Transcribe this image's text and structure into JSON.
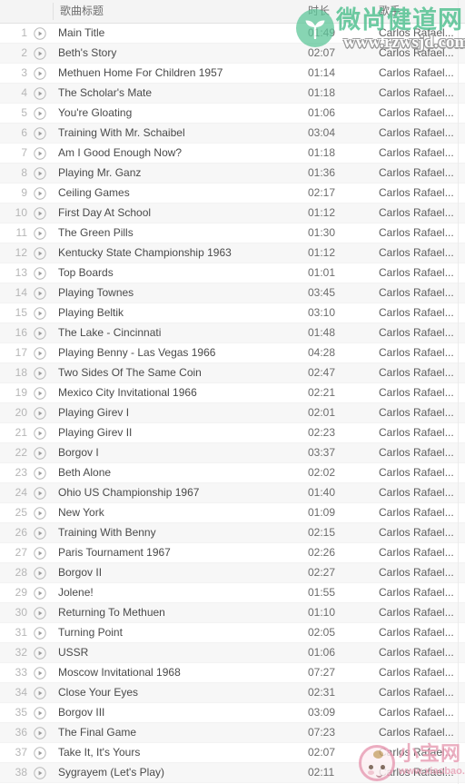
{
  "header": {
    "title_label": "歌曲标题",
    "duration_label": "时长",
    "artist_label": "歌手"
  },
  "colors": {
    "row_alt": "#f7f7f7",
    "header_bg": "#f4f4f4",
    "text": "#4a4a4a",
    "muted": "#b6b6b6",
    "watermark_green": "#4dbf8e",
    "watermark_pink": "#e79db3"
  },
  "icons": {
    "play": "play-circle-icon",
    "sprout": "sprout-logo-icon",
    "baby": "baby-face-icon"
  },
  "watermarks": {
    "top": {
      "brand": "微尚健道网",
      "url": "www.rzwsjd.com"
    },
    "bottom": {
      "brand": "小宝网",
      "url": "www.xiaobao.com"
    }
  },
  "tracks": [
    {
      "index": "1",
      "title": "Main Title",
      "duration": "01:49",
      "artist": "Carlos Rafael..."
    },
    {
      "index": "2",
      "title": "Beth's Story",
      "duration": "02:07",
      "artist": "Carlos Rafael..."
    },
    {
      "index": "3",
      "title": "Methuen Home For Children 1957",
      "duration": "01:14",
      "artist": "Carlos Rafael..."
    },
    {
      "index": "4",
      "title": "The Scholar's Mate",
      "duration": "01:18",
      "artist": "Carlos Rafael..."
    },
    {
      "index": "5",
      "title": "You're Gloating",
      "duration": "01:06",
      "artist": "Carlos Rafael..."
    },
    {
      "index": "6",
      "title": "Training With Mr. Schaibel",
      "duration": "03:04",
      "artist": "Carlos Rafael..."
    },
    {
      "index": "7",
      "title": "Am I Good Enough Now?",
      "duration": "01:18",
      "artist": "Carlos Rafael..."
    },
    {
      "index": "8",
      "title": "Playing Mr. Ganz",
      "duration": "01:36",
      "artist": "Carlos Rafael..."
    },
    {
      "index": "9",
      "title": "Ceiling Games",
      "duration": "02:17",
      "artist": "Carlos Rafael..."
    },
    {
      "index": "10",
      "title": "First Day At School",
      "duration": "01:12",
      "artist": "Carlos Rafael..."
    },
    {
      "index": "11",
      "title": "The Green Pills",
      "duration": "01:30",
      "artist": "Carlos Rafael..."
    },
    {
      "index": "12",
      "title": "Kentucky State Championship 1963",
      "duration": "01:12",
      "artist": "Carlos Rafael..."
    },
    {
      "index": "13",
      "title": "Top Boards",
      "duration": "01:01",
      "artist": "Carlos Rafael..."
    },
    {
      "index": "14",
      "title": "Playing Townes",
      "duration": "03:45",
      "artist": "Carlos Rafael..."
    },
    {
      "index": "15",
      "title": "Playing Beltik",
      "duration": "03:10",
      "artist": "Carlos Rafael..."
    },
    {
      "index": "16",
      "title": "The Lake - Cincinnati",
      "duration": "01:48",
      "artist": "Carlos Rafael..."
    },
    {
      "index": "17",
      "title": "Playing Benny - Las Vegas 1966",
      "duration": "04:28",
      "artist": "Carlos Rafael..."
    },
    {
      "index": "18",
      "title": "Two Sides Of The Same Coin",
      "duration": "02:47",
      "artist": "Carlos Rafael..."
    },
    {
      "index": "19",
      "title": "Mexico City Invitational 1966",
      "duration": "02:21",
      "artist": "Carlos Rafael..."
    },
    {
      "index": "20",
      "title": "Playing Girev I",
      "duration": "02:01",
      "artist": "Carlos Rafael..."
    },
    {
      "index": "21",
      "title": "Playing Girev II",
      "duration": "02:23",
      "artist": "Carlos Rafael..."
    },
    {
      "index": "22",
      "title": "Borgov I",
      "duration": "03:37",
      "artist": "Carlos Rafael..."
    },
    {
      "index": "23",
      "title": "Beth Alone",
      "duration": "02:02",
      "artist": "Carlos Rafael..."
    },
    {
      "index": "24",
      "title": "Ohio US Championship 1967",
      "duration": "01:40",
      "artist": "Carlos Rafael..."
    },
    {
      "index": "25",
      "title": "New York",
      "duration": "01:09",
      "artist": "Carlos Rafael..."
    },
    {
      "index": "26",
      "title": "Training With Benny",
      "duration": "02:15",
      "artist": "Carlos Rafael..."
    },
    {
      "index": "27",
      "title": "Paris Tournament 1967",
      "duration": "02:26",
      "artist": "Carlos Rafael..."
    },
    {
      "index": "28",
      "title": "Borgov II",
      "duration": "02:27",
      "artist": "Carlos Rafael..."
    },
    {
      "index": "29",
      "title": "Jolene!",
      "duration": "01:55",
      "artist": "Carlos Rafael..."
    },
    {
      "index": "30",
      "title": "Returning To Methuen",
      "duration": "01:10",
      "artist": "Carlos Rafael..."
    },
    {
      "index": "31",
      "title": "Turning Point",
      "duration": "02:05",
      "artist": "Carlos Rafael..."
    },
    {
      "index": "32",
      "title": "USSR",
      "duration": "01:06",
      "artist": "Carlos Rafael..."
    },
    {
      "index": "33",
      "title": "Moscow Invitational 1968",
      "duration": "07:27",
      "artist": "Carlos Rafael..."
    },
    {
      "index": "34",
      "title": "Close Your Eyes",
      "duration": "02:31",
      "artist": "Carlos Rafael..."
    },
    {
      "index": "35",
      "title": "Borgov III",
      "duration": "03:09",
      "artist": "Carlos Rafael..."
    },
    {
      "index": "36",
      "title": "The Final Game",
      "duration": "07:23",
      "artist": "Carlos Rafael..."
    },
    {
      "index": "37",
      "title": "Take It, It's Yours",
      "duration": "02:07",
      "artist": "Carlos Rafael..."
    },
    {
      "index": "38",
      "title": "Sygrayem (Let's Play)",
      "duration": "02:11",
      "artist": "Carlos Rafael..."
    }
  ]
}
